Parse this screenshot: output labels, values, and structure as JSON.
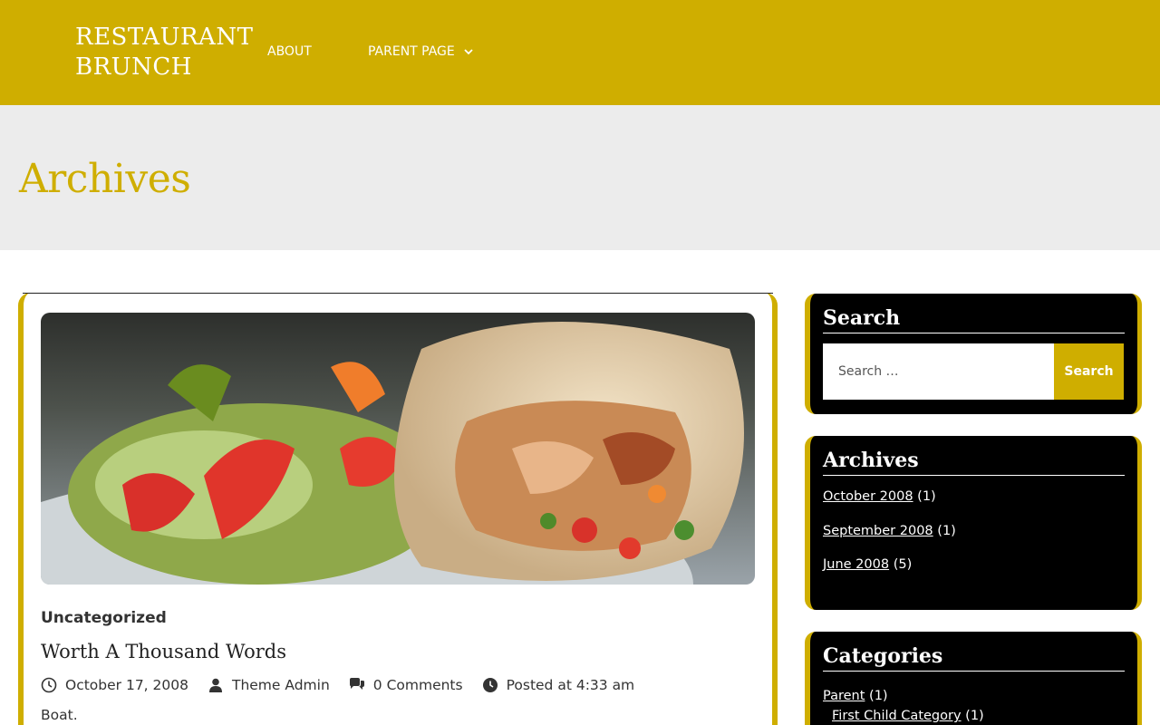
{
  "header": {
    "logo_line1": "RESTAURANT",
    "logo_line2": "BRUNCH",
    "nav": [
      {
        "label": "ABOUT"
      },
      {
        "label": "PARENT PAGE",
        "has_dropdown": true
      }
    ]
  },
  "page": {
    "title": "Archives"
  },
  "post": {
    "category": "Uncategorized",
    "title": "Worth A Thousand Words",
    "date": "October 17, 2008",
    "author": "Theme Admin",
    "comments": "0 Comments",
    "posted_at": "Posted at 4:33 am",
    "excerpt": "Boat."
  },
  "sidebar": {
    "search": {
      "title": "Search",
      "placeholder": "Search …",
      "button_label": "Search"
    },
    "archives": {
      "title": "Archives",
      "items": [
        {
          "label": "October 2008",
          "count": "(1)"
        },
        {
          "label": "September 2008",
          "count": "(1)"
        },
        {
          "label": "June 2008",
          "count": "(5)"
        }
      ]
    },
    "categories": {
      "title": "Categories",
      "items": [
        {
          "label": "Parent",
          "count": "(1)"
        },
        {
          "label": "First Child Category",
          "count": "(1)"
        }
      ]
    }
  },
  "colors": {
    "accent": "#cfae00",
    "band": "#ececec",
    "widget_bg": "#000000"
  }
}
